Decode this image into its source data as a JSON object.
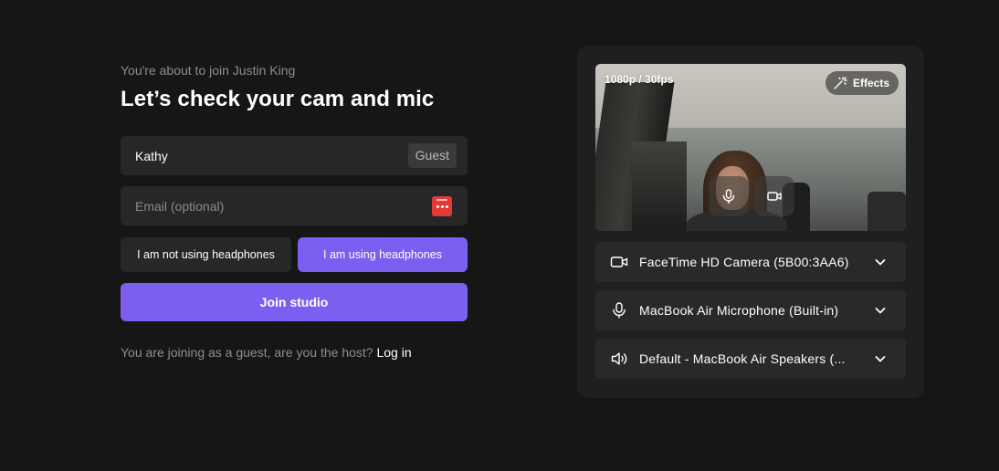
{
  "join": {
    "subtitle": "You're about to join Justin King",
    "title": "Let’s check your cam and mic",
    "name_value": "Kathy",
    "guest_badge": "Guest",
    "email_placeholder": "Email (optional)",
    "headphones_no": "I am not using headphones",
    "headphones_yes": "I am using headphones",
    "join_button": "Join studio",
    "guest_note": "You are joining as a guest, are you the host?",
    "login_link": "Log in"
  },
  "preview": {
    "resolution": "1080p / 30fps",
    "effects_label": "Effects"
  },
  "devices": {
    "camera": "FaceTime HD Camera (5B00:3AA6)",
    "microphone": "MacBook Air Microphone (Built-in)",
    "speaker": "Default - MacBook Air Speakers (..."
  },
  "icons": {
    "password_manager": "password-manager-icon",
    "effects": "magic-wand-icon",
    "mic": "microphone-icon",
    "camera": "video-camera-icon",
    "speaker": "speaker-icon",
    "chevron": "chevron-down-icon"
  },
  "colors": {
    "background": "#161616",
    "accent": "#7c5ff0",
    "field": "#272727",
    "panel": "#1f1f1f",
    "password_icon": "#e53935"
  }
}
